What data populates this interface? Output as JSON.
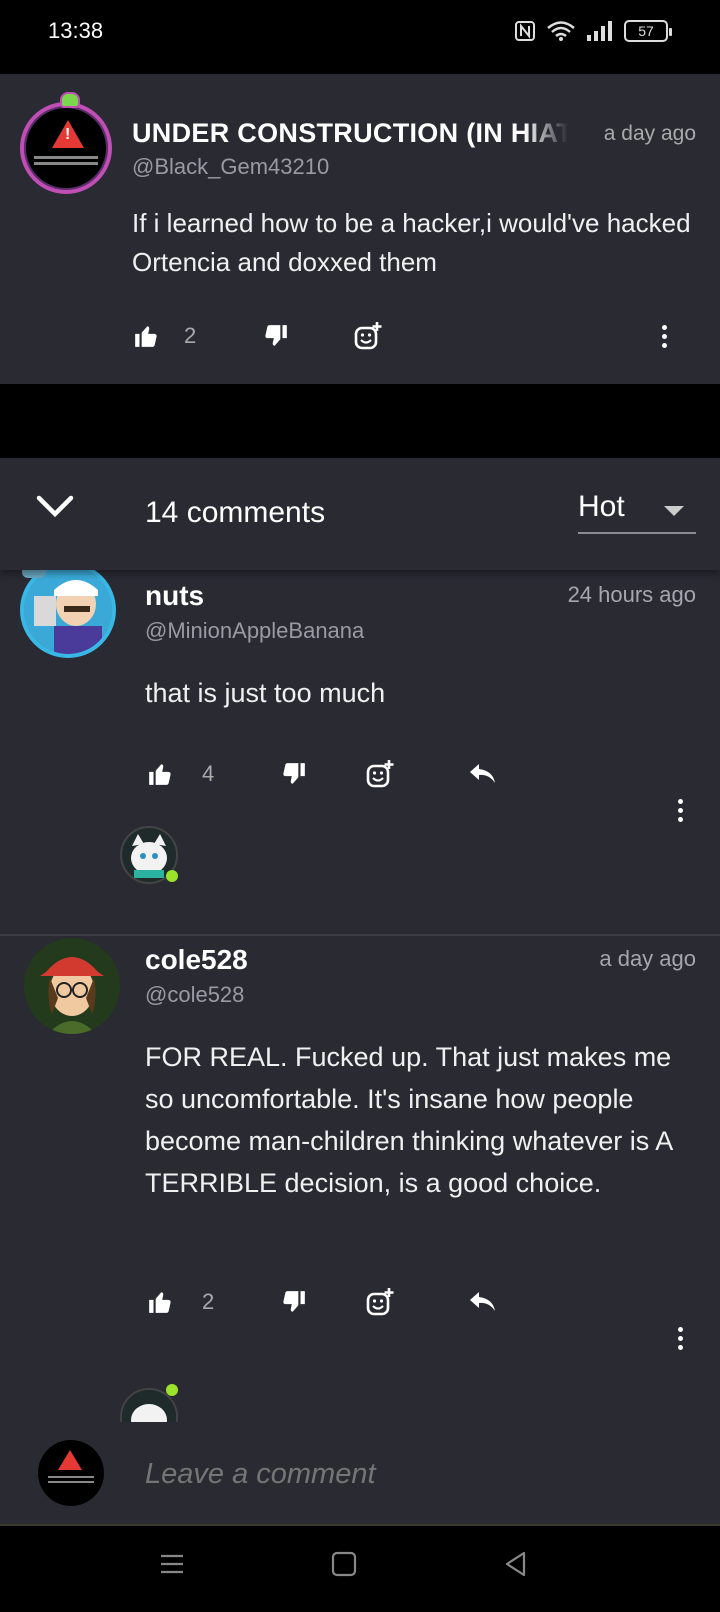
{
  "status_bar": {
    "time": "13:38",
    "battery": "57"
  },
  "post": {
    "author_name": "UNDER CONSTRUCTION (IN HIATUS)",
    "timestamp": "a day ago",
    "handle": "@Black_Gem43210",
    "text": "If i learned how to be a hacker,i would've hacked Ortencia and doxxed them",
    "like_count": "2"
  },
  "comments_header": {
    "count_label": "14 comments",
    "sort_value": "Hot"
  },
  "comments": [
    {
      "name": "nuts",
      "timestamp": "24 hours ago",
      "handle": "@MinionAppleBanana",
      "text": "that is just too much",
      "like_count": "4"
    },
    {
      "name": "cole528",
      "timestamp": "a day ago",
      "handle": "@cole528",
      "text": "FOR REAL. Fucked up. That just makes me so uncomfortable. It's insane how people become man-children thinking whatever is A TERRIBLE decision, is a good choice.",
      "like_count": "2"
    }
  ],
  "compose": {
    "placeholder": "Leave a comment"
  },
  "colors": {
    "background": "#2a2a33",
    "accent_avatar_ring": "#c04fb5",
    "online": "#9be22b",
    "warning": "#e53935"
  }
}
